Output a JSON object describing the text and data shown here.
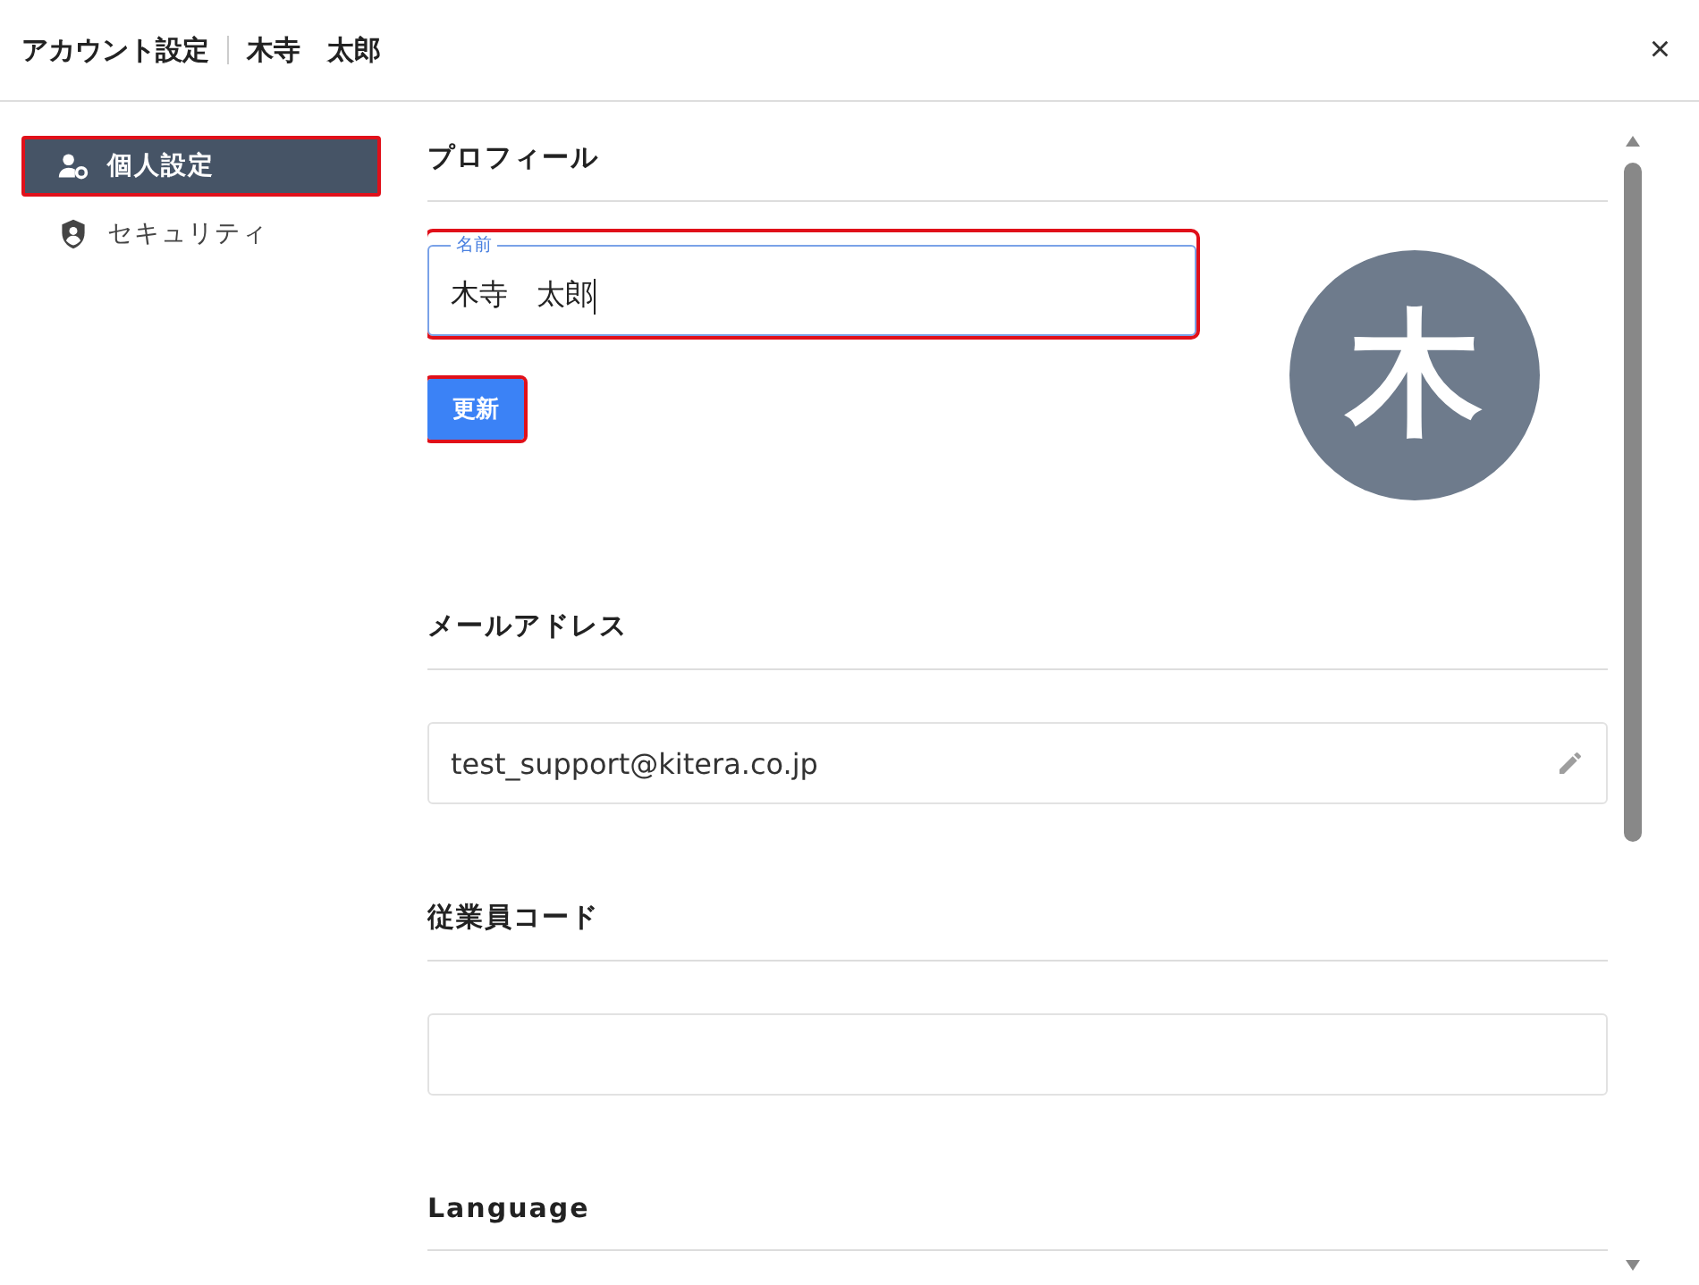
{
  "header": {
    "title": "アカウント設定",
    "user": "木寺　太郎",
    "close": "×"
  },
  "sidebar": {
    "items": [
      {
        "label": "個人設定",
        "selected": true,
        "highlighted": true
      },
      {
        "label": "セキュリティ",
        "selected": false,
        "highlighted": false
      }
    ]
  },
  "profile": {
    "heading": "プロフィール",
    "name_field": {
      "label": "名前",
      "value": "木寺　太郎",
      "highlighted": true
    },
    "update_button": {
      "label": "更新",
      "highlighted": true
    },
    "avatar": "木"
  },
  "email": {
    "heading": "メールアドレス",
    "value": "test_support@kitera.co.jp"
  },
  "employee_code": {
    "heading": "従業員コード"
  },
  "language": {
    "heading": "Language"
  }
}
